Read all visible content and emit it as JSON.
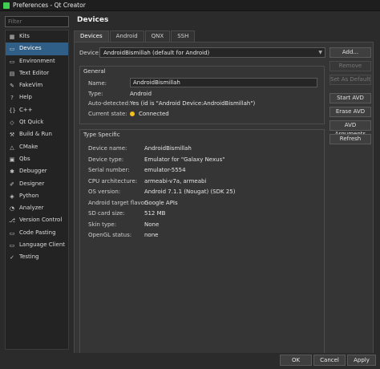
{
  "window": {
    "title": "Preferences - Qt Creator"
  },
  "sidebar": {
    "filter_placeholder": "Filter",
    "items": [
      {
        "label": "Kits",
        "icon": "kits-icon",
        "glyph": "▦"
      },
      {
        "label": "Devices",
        "icon": "devices-icon",
        "glyph": "▭"
      },
      {
        "label": "Environment",
        "icon": "environment-icon",
        "glyph": "▭"
      },
      {
        "label": "Text Editor",
        "icon": "text-editor-icon",
        "glyph": "▤"
      },
      {
        "label": "FakeVim",
        "icon": "fakevim-icon",
        "glyph": "✎"
      },
      {
        "label": "Help",
        "icon": "help-icon",
        "glyph": "?"
      },
      {
        "label": "C++",
        "icon": "cpp-icon",
        "glyph": "{}"
      },
      {
        "label": "Qt Quick",
        "icon": "qt-quick-icon",
        "glyph": "◇"
      },
      {
        "label": "Build & Run",
        "icon": "build-run-icon",
        "glyph": "⚒"
      },
      {
        "label": "CMake",
        "icon": "cmake-icon",
        "glyph": "△"
      },
      {
        "label": "Qbs",
        "icon": "qbs-icon",
        "glyph": "▣"
      },
      {
        "label": "Debugger",
        "icon": "debugger-icon",
        "glyph": "✱"
      },
      {
        "label": "Designer",
        "icon": "designer-icon",
        "glyph": "✐"
      },
      {
        "label": "Python",
        "icon": "python-icon",
        "glyph": "◈"
      },
      {
        "label": "Analyzer",
        "icon": "analyzer-icon",
        "glyph": "◔"
      },
      {
        "label": "Version Control",
        "icon": "version-control-icon",
        "glyph": "⎇"
      },
      {
        "label": "Code Pasting",
        "icon": "code-pasting-icon",
        "glyph": "▭"
      },
      {
        "label": "Language Client",
        "icon": "language-client-icon",
        "glyph": "▭"
      },
      {
        "label": "Testing",
        "icon": "testing-icon",
        "glyph": "✓"
      }
    ],
    "selected_index": 1
  },
  "page": {
    "title": "Devices",
    "tabs": [
      "Devices",
      "Android",
      "QNX",
      "SSH"
    ],
    "active_tab": 0
  },
  "device": {
    "label": "Device:",
    "selected": "AndroidBismillah (default for Android)"
  },
  "actions": {
    "add": "Add...",
    "remove": "Remove",
    "set_default": "Set As Default",
    "start_avd": "Start AVD",
    "erase_avd": "Erase AVD",
    "avd_arguments": "AVD Arguments",
    "refresh": "Refresh"
  },
  "general": {
    "title": "General",
    "name_label": "Name:",
    "name_value": "AndroidBismillah",
    "type_label": "Type:",
    "type_value": "Android",
    "auto_label": "Auto-detected:",
    "auto_value": "Yes (id is \"Android Device:AndroidBismillah\")",
    "state_label": "Current state:",
    "state_value": "Connected",
    "state_color": "#f2c21b"
  },
  "specific": {
    "title": "Type Specific",
    "rows": [
      {
        "k": "Device name:",
        "v": "AndroidBismillah"
      },
      {
        "k": "Device type:",
        "v": "Emulator for \"Galaxy Nexus\""
      },
      {
        "k": "Serial number:",
        "v": "emulator-5554"
      },
      {
        "k": "CPU architecture:",
        "v": "armeabi-v7a, armeabi"
      },
      {
        "k": "OS version:",
        "v": "Android 7.1.1 (Nougat) (SDK 25)"
      },
      {
        "k": "Android target flavor:",
        "v": "Google APIs"
      },
      {
        "k": "SD card size:",
        "v": "512 MB"
      },
      {
        "k": "Skin type:",
        "v": "None"
      },
      {
        "k": "OpenGL status:",
        "v": "none"
      }
    ]
  },
  "footer": {
    "ok": "OK",
    "cancel": "Cancel",
    "apply": "Apply"
  }
}
